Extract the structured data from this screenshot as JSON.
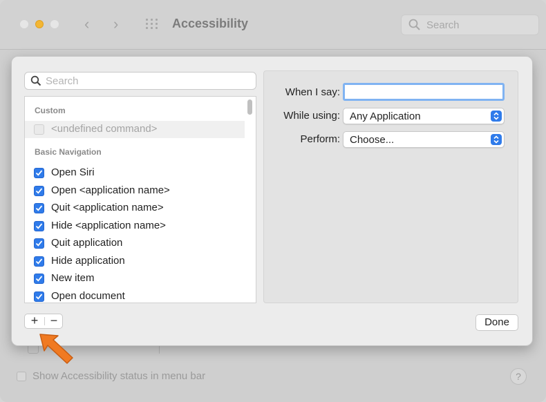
{
  "window": {
    "title": "Accessibility",
    "search_placeholder": "Search"
  },
  "background": {
    "status_checkbox_label": "Show Accessibility status in menu bar",
    "help_label": "?"
  },
  "sheet": {
    "search_placeholder": "Search",
    "sections": [
      {
        "header": "Custom",
        "items": [
          {
            "label": "<undefined command>",
            "checked": false,
            "disabled": true
          }
        ]
      },
      {
        "header": "Basic Navigation",
        "items": [
          {
            "label": "Open Siri",
            "checked": true
          },
          {
            "label": "Open <application name>",
            "checked": true
          },
          {
            "label": "Quit <application name>",
            "checked": true
          },
          {
            "label": "Hide <application name>",
            "checked": true
          },
          {
            "label": "Quit application",
            "checked": true
          },
          {
            "label": "Hide application",
            "checked": true
          },
          {
            "label": "New item",
            "checked": true
          },
          {
            "label": "Open document",
            "checked": true
          }
        ]
      }
    ],
    "form": {
      "when_i_say_label": "When I say:",
      "when_i_say_value": "",
      "while_using_label": "While using:",
      "while_using_value": "Any Application",
      "perform_label": "Perform:",
      "perform_value": "Choose..."
    },
    "add_label": "+",
    "remove_label": "−",
    "done_label": "Done"
  },
  "colors": {
    "accent": "#2f7bea",
    "annotation_arrow": "#f07a22"
  }
}
